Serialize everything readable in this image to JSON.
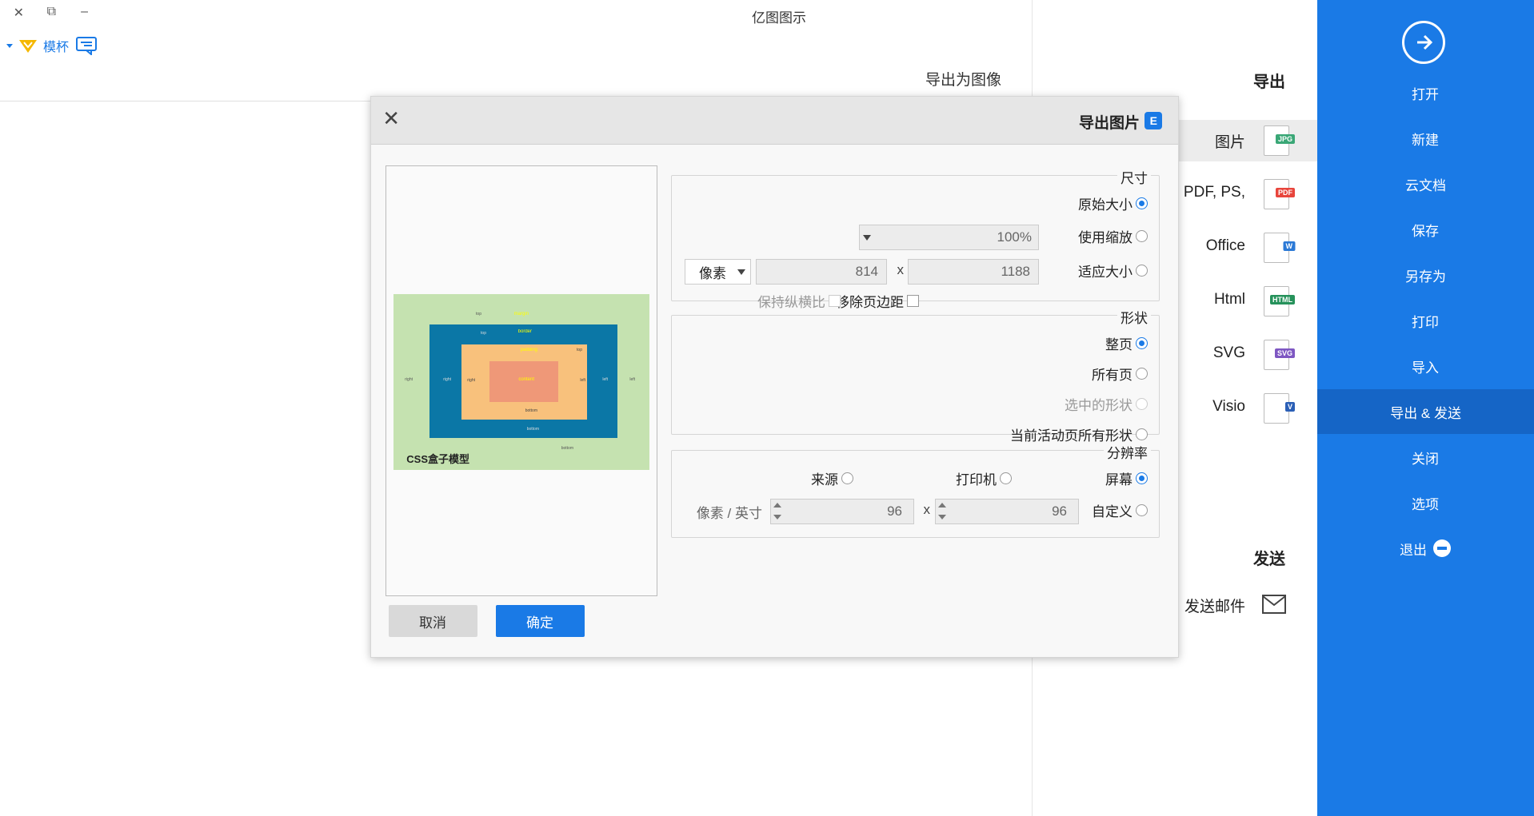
{
  "app": {
    "title": "亿图图示"
  },
  "window": {
    "close": "✕",
    "restore": "⧉",
    "minimize": "–"
  },
  "topbar": {
    "vip_label": "模杯"
  },
  "page_heading": "导出为图像",
  "sidebar": {
    "items": [
      {
        "label": "打开"
      },
      {
        "label": "新建"
      },
      {
        "label": "云文档"
      },
      {
        "label": "保存"
      },
      {
        "label": "另存为"
      },
      {
        "label": "打印"
      },
      {
        "label": "导入"
      },
      {
        "label": "导出 & 发送"
      },
      {
        "label": "关闭"
      },
      {
        "label": "选项"
      },
      {
        "label": "退出"
      }
    ]
  },
  "export_panel": {
    "export_heading": "导出",
    "send_heading": "发送",
    "formats": [
      {
        "label": "图片",
        "tag": "JPG",
        "color": "#3aa776"
      },
      {
        "label": "PDF, PS,",
        "tag": "PDF",
        "color": "#e8453c"
      },
      {
        "label": "Office",
        "tag": "W",
        "color": "#2b79d6"
      },
      {
        "label": "Html",
        "tag": "HTML",
        "color": "#26925b"
      },
      {
        "label": "SVG",
        "tag": "SVG",
        "color": "#7e57c2"
      },
      {
        "label": "Visio",
        "tag": "V",
        "color": "#2b5fb6"
      }
    ],
    "send_email": "发送邮件"
  },
  "dialog": {
    "title": "导出图片",
    "logo": "E",
    "close": "✕",
    "size": {
      "title": "尺寸",
      "original": "原始大小",
      "zoom": "使用缩放",
      "zoom_value": "100%",
      "fit": "适应大小",
      "width": "1188",
      "x": "x",
      "height": "814",
      "unit": "像素",
      "remove_margin": "移除页边距",
      "keep_ratio": "保持纵横比"
    },
    "shape": {
      "title": "形状",
      "whole_page": "整页",
      "all_pages": "所有页",
      "selected": "选中的形状",
      "current_all": "当前活动页所有形状"
    },
    "resolution": {
      "title": "分辨率",
      "screen": "屏幕",
      "printer": "打印机",
      "source": "来源",
      "custom": "自定义",
      "dpi_x": "96",
      "x": "x",
      "dpi_y": "96",
      "unit": "像素 / 英寸"
    },
    "preview": {
      "caption": "CSS盒子模型",
      "labels": {
        "margin": "margin",
        "border": "border",
        "padding": "padding",
        "content": "content",
        "top": "top",
        "bottom": "bottom",
        "left": "left",
        "right": "right"
      }
    },
    "ok": "确定",
    "cancel": "取消"
  }
}
